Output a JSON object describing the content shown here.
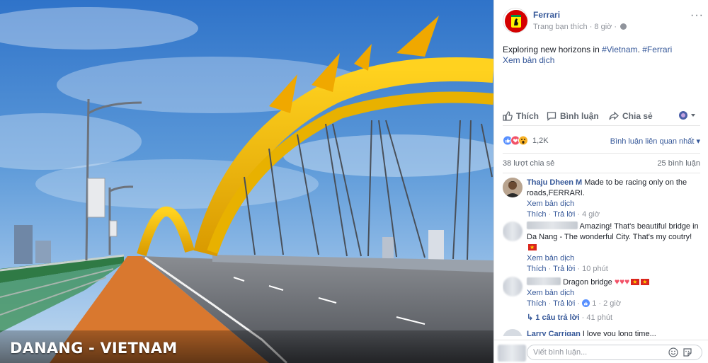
{
  "photo": {
    "caption": "DANANG - VIETNAM"
  },
  "post": {
    "page_name": "Ferrari",
    "meta": "Trang bạn thích · 8 giờ ·",
    "more": "···",
    "text_prefix": "Exploring new horizons in ",
    "hashtag_1": "#Vietnam",
    "text_middle": ". ",
    "hashtag_2": "#Ferrari",
    "see_translation": "Xem bản dịch"
  },
  "actions": {
    "like": "Thích",
    "comment": "Bình luận",
    "share": "Chia sẻ"
  },
  "stats": {
    "reactions_count": "1,2K",
    "sort_label": "Bình luận liên quan nhất",
    "shares": "38 lượt chia sẻ",
    "comments_count": "25 bình luận"
  },
  "comments": [
    {
      "author": "Thaju Dheen M",
      "text": "Made to be racing only on the roads,FERRARI.",
      "see_translation": "Xem bản dịch",
      "like": "Thích",
      "reply": "Trả lời",
      "time": "4 giờ"
    },
    {
      "author": "",
      "text": "Amazing! That's beautiful bridge in Da Nang - The wonderful City. That's my coutry!",
      "see_translation": "Xem bản dịch",
      "like": "Thích",
      "reply": "Trả lời",
      "time": "10 phút"
    },
    {
      "author": "",
      "text": "Dragon bridge",
      "see_translation": "Xem bản dịch",
      "like": "Thích",
      "reply": "Trả lời",
      "likes": "1",
      "time": "2 giờ",
      "replies_label": "1 câu trả lời",
      "replies_time": "41 phút"
    },
    {
      "author": "Larry Carrigan",
      "text": "I love you long time..."
    }
  ],
  "composer": {
    "placeholder": "Viết bình luận..."
  },
  "colors": {
    "link": "#365899",
    "meta": "#90949c",
    "ferrari_red": "#d40000",
    "ferrari_yellow": "#fff200"
  }
}
